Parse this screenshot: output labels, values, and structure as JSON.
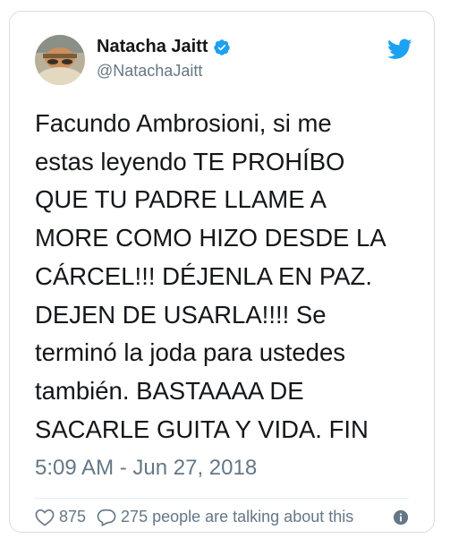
{
  "tweet": {
    "author_name": "Natacha Jaitt",
    "author_handle": "@NatachaJaitt",
    "text": "Facundo Ambrosioni, si me\nestas leyendo TE PROHÍBO\nQUE TU PADRE LLAME A\nMORE COMO HIZO DESDE LA\nCÁRCEL!!! DÉJENLA EN PAZ.\nDEJEN DE USARLA!!!! Se\nterminó la joda para ustedes\ntambién. BASTAAAA DE\nSACARLE GUITA Y VIDA. FIN",
    "timestamp": "5:09 AM - Jun 27, 2018",
    "like_count": "875",
    "talking_text": "275 people are talking about this"
  },
  "icons": {
    "verified": "verified-badge-icon",
    "brand": "twitter-bird-icon",
    "like": "heart-icon",
    "reply": "speech-bubble-icon",
    "info": "info-icon"
  },
  "colors": {
    "twitter_blue": "#1da1f2",
    "text": "#14171a",
    "muted": "#657786",
    "border": "#d7dde2"
  }
}
